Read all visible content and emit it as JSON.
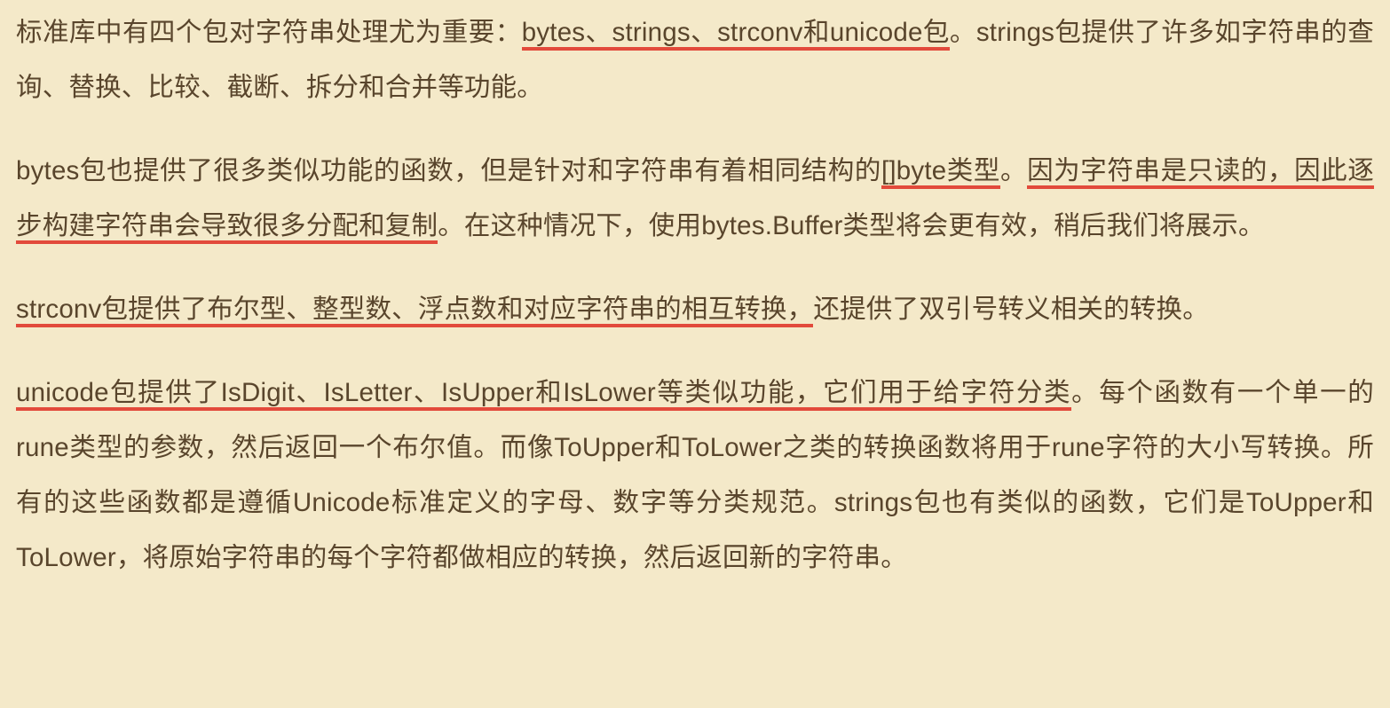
{
  "paragraphs": {
    "p1": {
      "s1": "标准库中有四个包对字符串处理尤为重要：",
      "s2_ul": "bytes、strings、strconv和unicode包",
      "s3": "。strings包提供了许多如字符串的查询、替换、比较、截断、拆分和合并等功能。"
    },
    "p2": {
      "s1": "bytes包也提供了很多类似功能的函数，但是针对和字符串有着相同结构的",
      "s2_ul": "[]byte类型",
      "s3": "。",
      "s4_ul": "因为字符串是只读的，因此逐步构建字符串会导致很多分配和复制",
      "s5": "。在这种情况下，使用bytes.Buffer类型将会更有效，稍后我们将展示。"
    },
    "p3": {
      "s1_ul": "strconv包提供了布尔型、整型数、浮点数和对应字符串的相互转换，",
      "s2": "还提供了双引号转义相关的转换。"
    },
    "p4": {
      "s1_ul": "unicode包提供了IsDigit、IsLetter、IsUpper和IsLower等类似功能，它们用于给字符分类",
      "s2": "。每个函数有一个单一的rune类型的参数，然后返回一个布尔值。而像ToUpper和ToLower之类的转换函数将用于rune字符的大小写转换。所有的这些函数都是遵循Unicode标准定义的字母、数字等分类规范。strings包也有类似的函数，它们是ToUpper和ToLower，将原始字符串的每个字符都做相应的转换，然后返回新的字符串。"
    }
  }
}
